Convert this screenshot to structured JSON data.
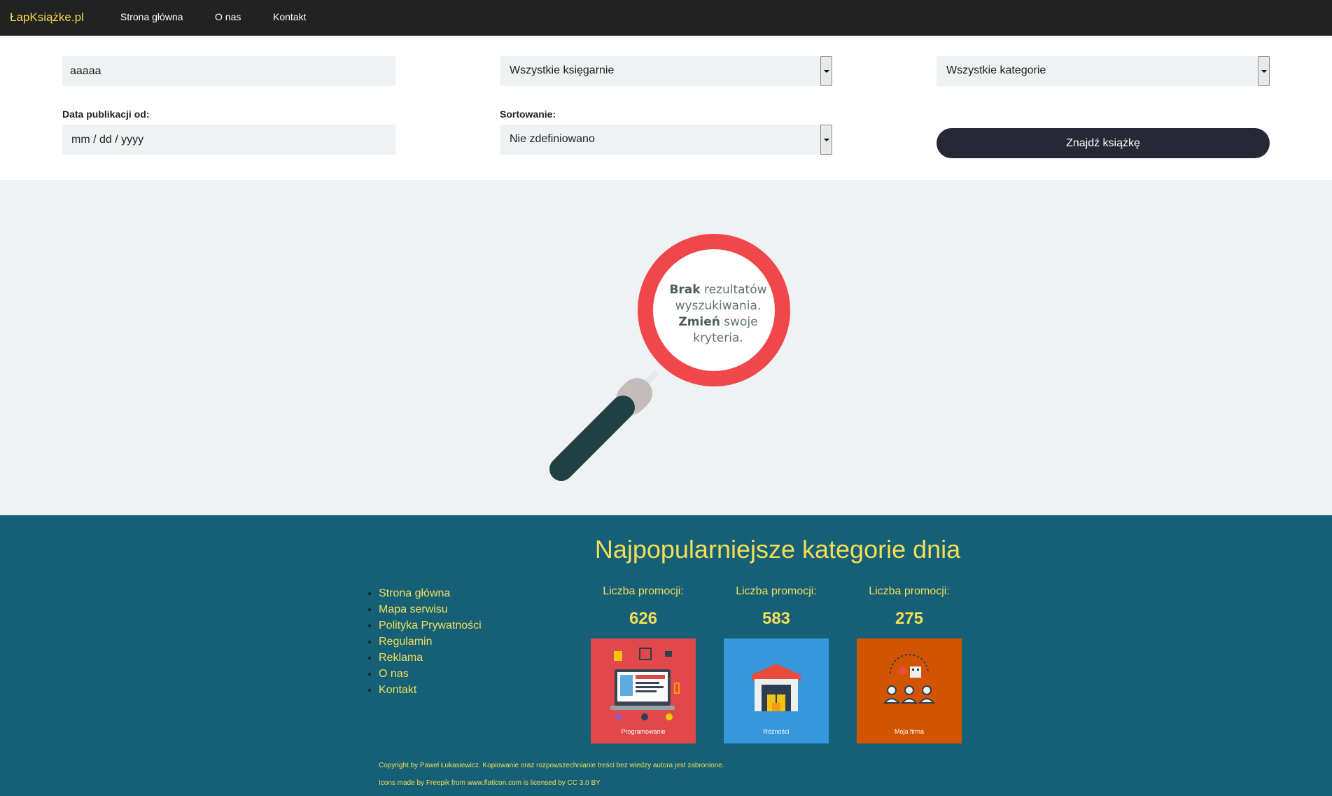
{
  "navbar": {
    "brand": "ŁapKsiążke.pl",
    "links": [
      "Strona główna",
      "O nas",
      "Kontakt"
    ]
  },
  "search": {
    "query": "aaaaa",
    "bookstore_selected": "Wszystkie księgarnie",
    "category_selected": "Wszystkie kategorie",
    "date_label": "Data publikacji od:",
    "date_placeholder": "mm / dd / yyyy",
    "sort_label": "Sortowanie:",
    "sort_selected": "Nie zdefiniowano",
    "submit_label": "Znajdź książkę"
  },
  "results": {
    "line1_bold": "Brak",
    "line1_rest": " rezultatów",
    "line2": "wyszukiwania.",
    "line3_bold": "Zmień",
    "line3_rest": " swoje",
    "line4": "kryteria."
  },
  "footer": {
    "heading": "Najpopularniejsze kategorie dnia",
    "links": [
      "Strona główna",
      "Mapa serwisu",
      "Polityka Prywatności",
      "Regulamin",
      "Reklama",
      "O nas",
      "Kontakt"
    ],
    "categories": [
      {
        "label": "Liczba promocji:",
        "count": "626",
        "name": "Programowanie",
        "color": "#e0484a"
      },
      {
        "label": "Liczba promocji:",
        "count": "583",
        "name": "Różności",
        "color": "#3498db"
      },
      {
        "label": "Liczba promocji:",
        "count": "275",
        "name": "Moja firma",
        "color": "#d35400"
      }
    ],
    "copyright": "Copyright by Paweł Łukasiewicz. Kopiowanie oraz rozpowszechnianie treści bez wiedzy autora jest zabronione.",
    "icons_credit": "Icons made by Freepik from www.flaticon.com is licensed by CC 3.0 BY"
  },
  "colors": {
    "navbar_bg": "#222222",
    "brand": "#f2d84b",
    "footer_bg": "#156077",
    "footer_accent": "#f5de55",
    "button_bg": "#272836",
    "magnifier_ring": "#f0474a",
    "magnifier_handle": "#1f4144"
  }
}
